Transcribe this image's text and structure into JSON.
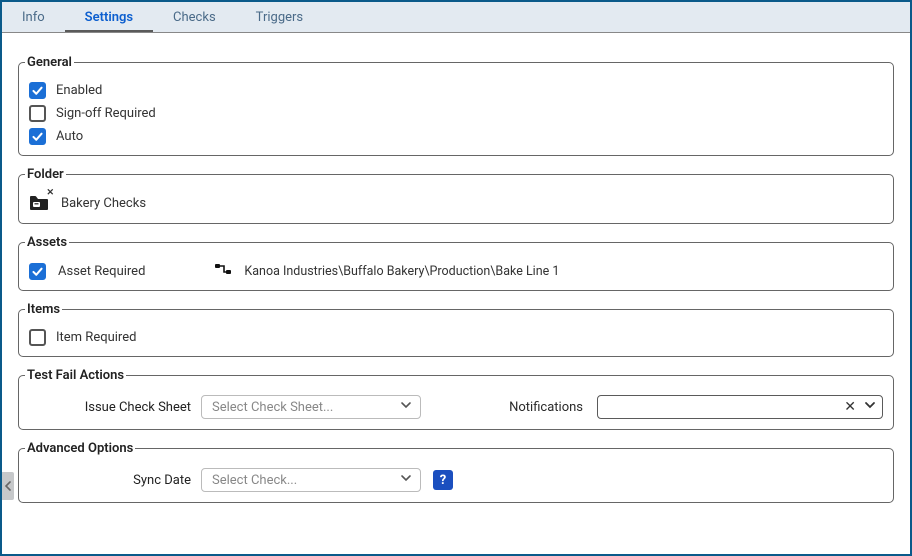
{
  "tabs": [
    {
      "label": "Info",
      "active": false
    },
    {
      "label": "Settings",
      "active": true
    },
    {
      "label": "Checks",
      "active": false
    },
    {
      "label": "Triggers",
      "active": false
    }
  ],
  "general": {
    "legend": "General",
    "enabled": {
      "label": "Enabled",
      "checked": true
    },
    "signoff": {
      "label": "Sign-off Required",
      "checked": false
    },
    "auto": {
      "label": "Auto",
      "checked": true
    }
  },
  "folder": {
    "legend": "Folder",
    "name": "Bakery Checks"
  },
  "assets": {
    "legend": "Assets",
    "required": {
      "label": "Asset Required",
      "checked": true
    },
    "path": "Kanoa Industries\\Buffalo Bakery\\Production\\Bake Line 1"
  },
  "items": {
    "legend": "Items",
    "required": {
      "label": "Item Required",
      "checked": false
    }
  },
  "tfa": {
    "legend": "Test Fail Actions",
    "issue_label": "Issue Check Sheet",
    "issue_placeholder": "Select Check Sheet...",
    "notif_label": "Notifications"
  },
  "advanced": {
    "legend": "Advanced Options",
    "sync_label": "Sync Date",
    "sync_placeholder": "Select Check..."
  }
}
